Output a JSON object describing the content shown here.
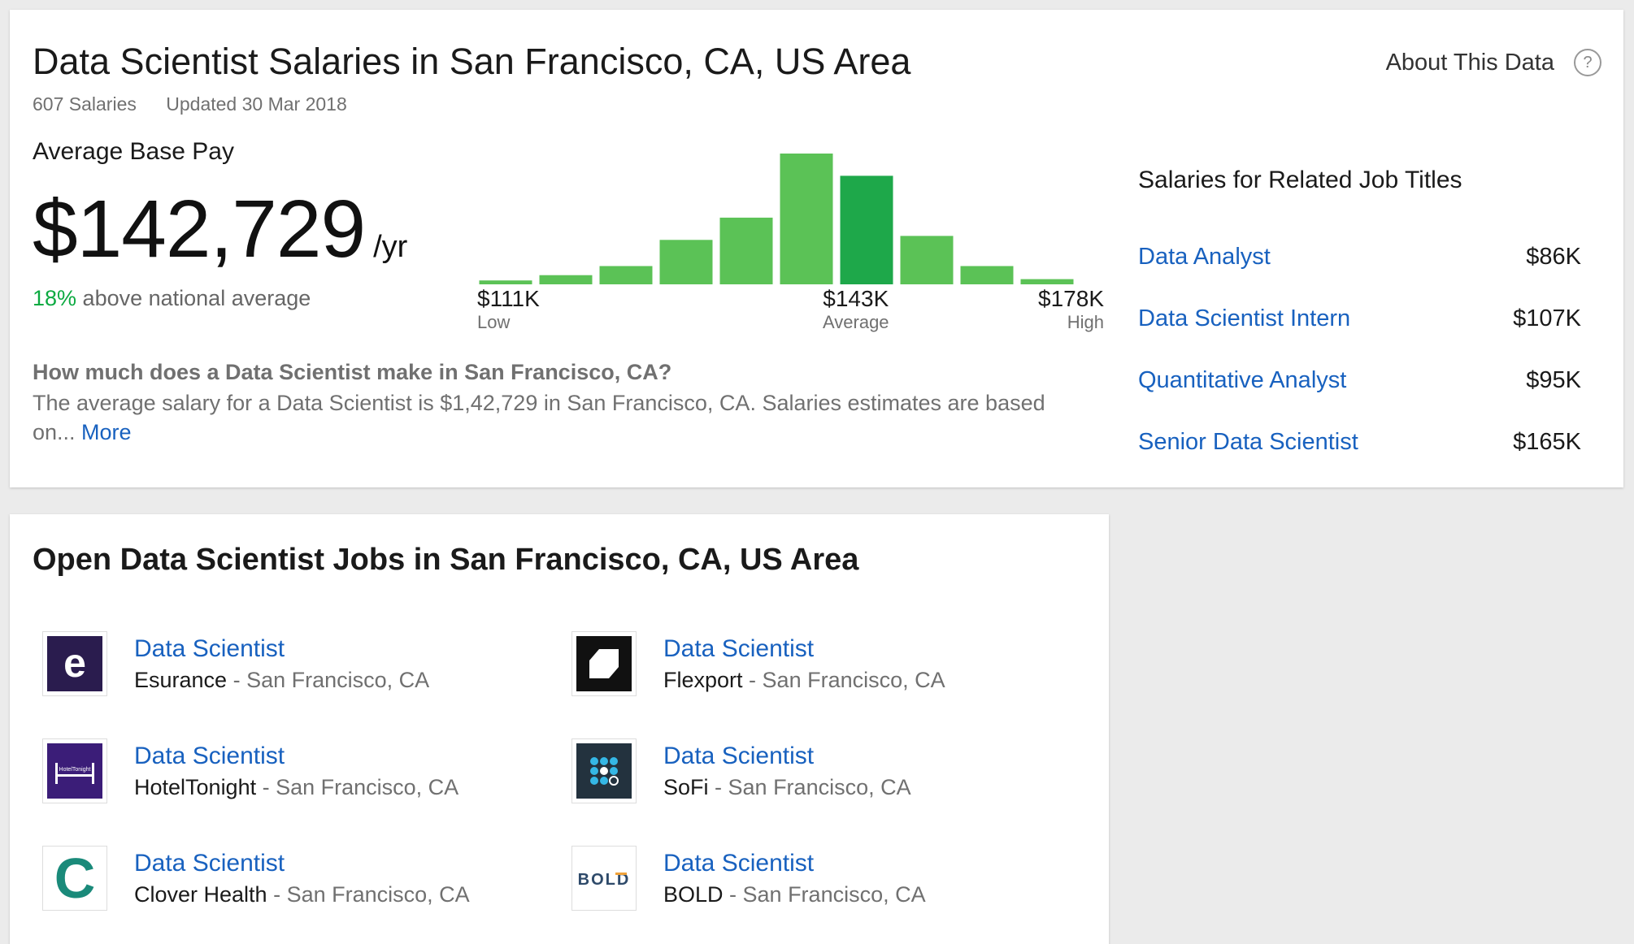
{
  "header": {
    "title": "Data Scientist Salaries in San Francisco, CA, US Area",
    "salary_count": "607 Salaries",
    "updated": "Updated 30 Mar 2018",
    "about_label": "About This Data",
    "help_glyph": "?"
  },
  "pay": {
    "label": "Average Base Pay",
    "value": "$142,729",
    "unit": "/yr",
    "compare_pct": "18%",
    "compare_text": " above national average"
  },
  "chart_data": {
    "type": "bar",
    "bar_heights_relative": [
      0.03,
      0.07,
      0.14,
      0.34,
      0.51,
      1.0,
      0.83,
      0.37,
      0.14,
      0.04
    ],
    "highlight_index": 6,
    "colors": {
      "bar": "#5bc256",
      "highlight": "#1ea84a"
    },
    "labels": {
      "low": {
        "value": "$111K",
        "caption": "Low"
      },
      "average": {
        "value": "$143K",
        "caption": "Average"
      },
      "high": {
        "value": "$178K",
        "caption": "High"
      }
    }
  },
  "faq": {
    "question": "How much does a Data Scientist make in San Francisco, CA?",
    "answer": "The average salary for a Data Scientist is $1,42,729 in San Francisco, CA. Salaries estimates are based on... ",
    "more_label": "More"
  },
  "related": {
    "title": "Salaries for Related Job Titles",
    "items": [
      {
        "label": "Data Analyst",
        "value": "$86K"
      },
      {
        "label": "Data Scientist Intern",
        "value": "$107K"
      },
      {
        "label": "Quantitative Analyst",
        "value": "$95K"
      },
      {
        "label": "Senior Data Scientist",
        "value": "$165K"
      }
    ]
  },
  "jobs": {
    "title": "Open Data Scientist Jobs in San Francisco, CA, US Area",
    "items": [
      {
        "title": "Data Scientist",
        "company": "Esurance",
        "location": " - San Francisco, CA",
        "logo": "esurance-logo"
      },
      {
        "title": "Data Scientist",
        "company": "Flexport",
        "location": " - San Francisco, CA",
        "logo": "flexport-logo"
      },
      {
        "title": "Data Scientist",
        "company": "HotelTonight",
        "location": " - San Francisco, CA",
        "logo": "hoteltonight-logo"
      },
      {
        "title": "Data Scientist",
        "company": "SoFi",
        "location": " - San Francisco, CA",
        "logo": "sofi-logo"
      },
      {
        "title": "Data Scientist",
        "company": "Clover Health",
        "location": " - San Francisco, CA",
        "logo": "clover-health-logo"
      },
      {
        "title": "Data Scientist",
        "company": "BOLD",
        "location": " - San Francisco, CA",
        "logo": "bold-logo"
      }
    ],
    "logo_text": {
      "esurance": "e",
      "hoteltonight": "HotelTonight",
      "clover": "C",
      "bold": "BOLD"
    }
  }
}
